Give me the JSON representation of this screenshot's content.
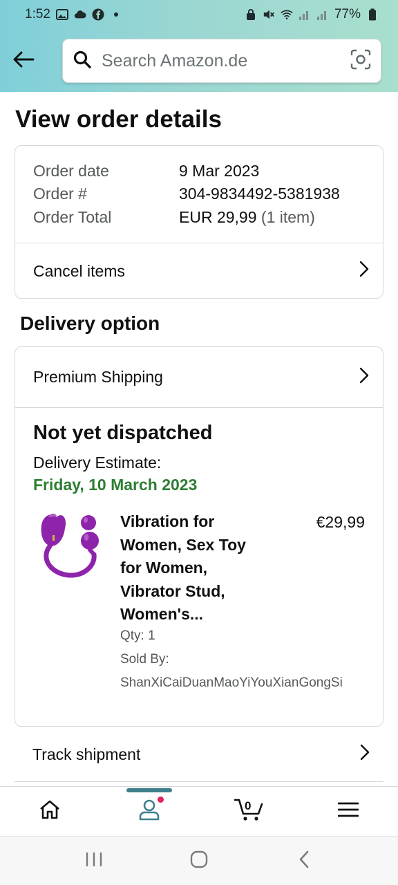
{
  "status_bar": {
    "time": "1:52",
    "battery": "77%",
    "left_icons": [
      "image-icon",
      "cloud-icon",
      "facebook-icon",
      "dot-icon"
    ],
    "right_icons": [
      "lock-icon",
      "mute-icon",
      "wifi-icon",
      "signal-icon",
      "signal-icon",
      "battery-icon"
    ]
  },
  "search": {
    "placeholder": "Search Amazon.de",
    "value": ""
  },
  "page": {
    "title": "View order details"
  },
  "order": {
    "date_label": "Order date",
    "date_value": "9 Mar 2023",
    "number_label": "Order #",
    "number_value": "304-9834492-5381938",
    "total_label": "Order Total",
    "total_value": "EUR 29,99",
    "total_items": "(1 item)",
    "cancel_label": "Cancel items"
  },
  "delivery": {
    "section_title": "Delivery option",
    "option_label": "Premium Shipping",
    "status": "Not yet dispatched",
    "estimate_label": "Delivery Estimate:",
    "estimate_date": "Friday, 10 March 2023",
    "estimate_color": "#2e7d32"
  },
  "product": {
    "title_lines": [
      "Vibration for",
      "Women, Sex Toy",
      "for Women,",
      "Vibrator Stud,",
      "Women's..."
    ],
    "price": "€29,99",
    "qty": "Qty: 1",
    "sold_by_label": "Sold By:",
    "seller": "ShanXiCaiDuanMaoYiYouXianGongSi",
    "image_color": "#8e24aa"
  },
  "track": {
    "label": "Track shipment"
  },
  "bottom_nav": {
    "items": [
      "home-icon",
      "account-icon",
      "cart-icon",
      "menu-icon"
    ],
    "cart_count": "0",
    "active_color": "#3e7f8c"
  },
  "system_nav": {
    "items": [
      "recents-icon",
      "home-button-icon",
      "back-icon"
    ]
  }
}
